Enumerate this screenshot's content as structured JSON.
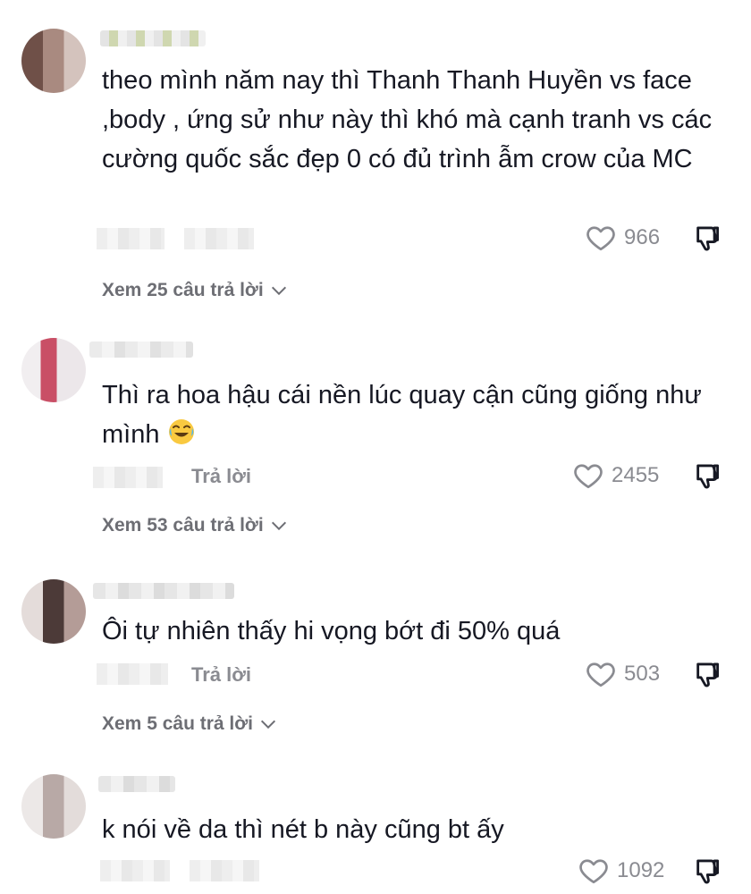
{
  "comments": [
    {
      "text": "theo mình năm nay thì Thanh Thanh Huyền vs face ,body , ứng sử như này thì khó mà cạnh tranh vs các cường quốc sắc đẹp 0 có đủ trình ẫm crow của MC",
      "reply_label": "",
      "likes": "966",
      "view_replies": "Xem 25 câu trả lời"
    },
    {
      "text": "Thì ra hoa hậu cái nền lúc quay cận cũng giống như mình",
      "reply_label": "Trả lời",
      "likes": "2455",
      "view_replies": "Xem 53 câu trả lời"
    },
    {
      "text": "Ôi tự nhiên thấy hi vọng bớt đi 50% quá",
      "reply_label": "Trả lời",
      "likes": "503",
      "view_replies": "Xem 5 câu trả lời"
    },
    {
      "text": "k nói về da thì nét b này cũng bt ấy",
      "reply_label": "",
      "likes": "1092",
      "view_replies": ""
    }
  ],
  "icons": {
    "like": "heart-outline-icon",
    "dislike": "thumbs-down-icon",
    "expand": "chevron-down-icon",
    "emoji": "face-with-tears-of-joy"
  },
  "colors": {
    "text": "#161823",
    "muted": "#8a8b91",
    "view_replies": "#6d6e74"
  }
}
